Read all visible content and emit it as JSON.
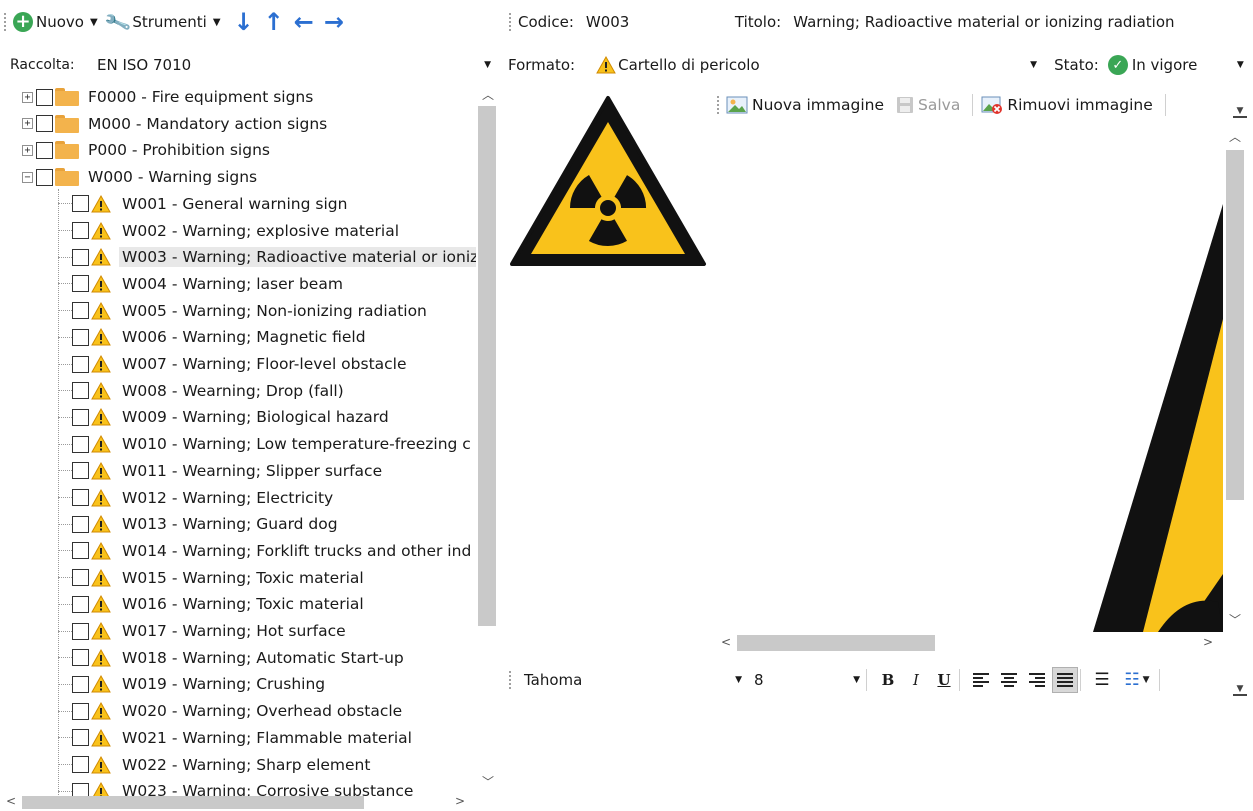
{
  "toolbar": {
    "new_label": "Nuovo",
    "tools_label": "Strumenti",
    "arrows": [
      "↓",
      "↑",
      "←",
      "→"
    ]
  },
  "raccolta": {
    "label": "Raccolta:",
    "value": "EN ISO 7010"
  },
  "tree": {
    "folders": [
      {
        "label": "F0000 - Fire equipment signs",
        "expander": "+"
      },
      {
        "label": "M000 - Mandatory action signs",
        "expander": "+"
      },
      {
        "label": "P000 - Prohibition signs",
        "expander": "+"
      },
      {
        "label": "W000 - Warning  signs",
        "expander": "−"
      }
    ],
    "items": [
      "W001 - General warning sign",
      "W002 - Warning; explosive material",
      "W003 - Warning; Radioactive material or ioniz",
      "W004 - Warning; laser beam",
      "W005 - Warning; Non-ionizing radiation",
      "W006 - Warning; Magnetic field",
      "W007 - Warning; Floor-level obstacle",
      "W008 - Wearning; Drop (fall)",
      "W009 - Warning; Biological hazard",
      "W010 - Warning; Low temperature-freezing c",
      "W011 - Wearning; Slipper surface",
      "W012 - Warning; Electricity",
      "W013 - Warning; Guard dog",
      "W014 - Warning; Forklift trucks and other ind",
      "W015 - Warning; Toxic material",
      "W016 - Warning; Toxic material",
      "W017 - Warning; Hot surface",
      "W018 - Warning; Automatic Start-up",
      "W019 - Warning; Crushing",
      "W020 - Warning; Overhead obstacle",
      "W021 - Warning; Flammable material",
      "W022 - Warning; Sharp element",
      "W023 - Warning; Corrosive substance"
    ],
    "selected_index": 2
  },
  "record": {
    "code_label": "Codice:",
    "code_value": "W003",
    "title_label": "Titolo:",
    "title_value": "Warning; Radioactive material or ionizing radiation",
    "format_label": "Formato:",
    "format_value": "Cartello di pericolo",
    "state_label": "Stato:",
    "state_value": "In vigore"
  },
  "image_toolbar": {
    "new_image": "Nuova immagine",
    "save": "Salva",
    "remove_image": "Rimuovi immagine"
  },
  "format_toolbar": {
    "font": "Tahoma",
    "size": "8",
    "bold": "B",
    "italic": "I",
    "underline": "U",
    "active_alignment": "justify"
  },
  "colors": {
    "sign_yellow": "#f9c21b",
    "sign_black": "#111111",
    "accent_blue": "#2b6fd1",
    "accent_green": "#3aa655",
    "selection": "#e8e8e8"
  }
}
